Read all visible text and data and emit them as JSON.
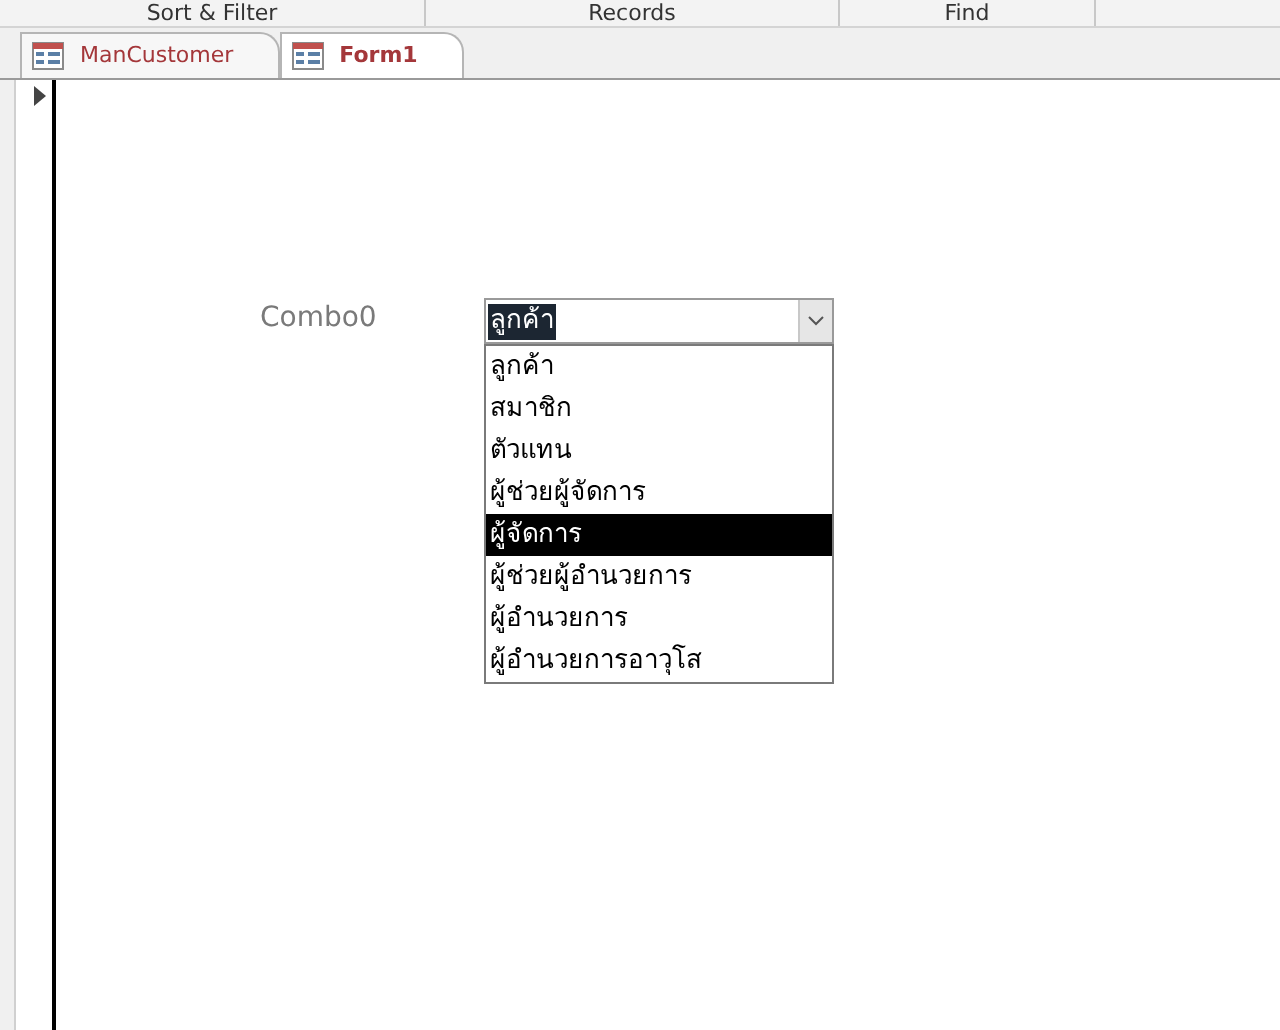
{
  "ribbon_groups": [
    "Sort & Filter",
    "Records",
    "Find"
  ],
  "tabs": [
    {
      "label": "ManCustomer",
      "selected": false
    },
    {
      "label": "Form1",
      "selected": true
    }
  ],
  "combo": {
    "label": "Combo0",
    "value": "ลูกค้า",
    "expanded": true,
    "options": [
      {
        "label": "ลูกค้า",
        "highlighted": false
      },
      {
        "label": "สมาชิก",
        "highlighted": false
      },
      {
        "label": "ตัวแทน",
        "highlighted": false
      },
      {
        "label": "ผู้ช่วยผู้จัดการ",
        "highlighted": false
      },
      {
        "label": "ผู้จัดการ",
        "highlighted": true
      },
      {
        "label": "ผู้ช่วยผู้อำนวยการ",
        "highlighted": false
      },
      {
        "label": "ผู้อำนวยการ",
        "highlighted": false
      },
      {
        "label": "ผู้อำนวยการอาวุโส",
        "highlighted": false
      }
    ]
  }
}
